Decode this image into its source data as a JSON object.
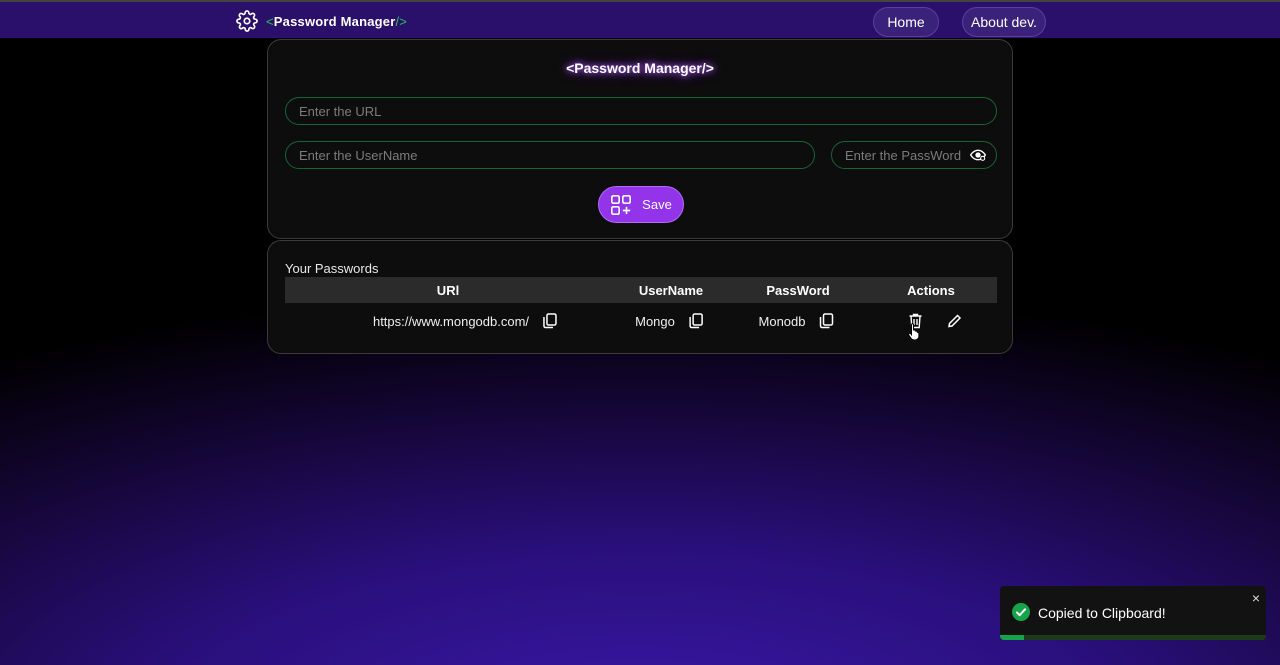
{
  "navbar": {
    "brand_open": "<",
    "brand_name": "Password Manager",
    "brand_close": "/>",
    "brand_icon": "gear-icon",
    "links": [
      {
        "label": "Home"
      },
      {
        "label": "About dev."
      }
    ]
  },
  "form": {
    "title": "<Password Manager/>",
    "url_placeholder": "Enter the URL",
    "url_value": "",
    "username_placeholder": "Enter the UserName",
    "username_value": "",
    "password_placeholder": "Enter the PassWord",
    "password_value": "",
    "save_label": "Save",
    "save_icon": "add-grid-icon",
    "password_toggle_icon": "eye-icon"
  },
  "passwords": {
    "title": "Your Passwords",
    "headers": {
      "url": "URl",
      "username": "UserName",
      "password": "PassWord",
      "actions": "Actions"
    },
    "rows": [
      {
        "url": "https://www.mongodb.com/",
        "username": "Mongo",
        "password": "Monodb"
      }
    ],
    "action_icons": [
      "copy-icon",
      "trash-icon",
      "pencil-icon"
    ]
  },
  "toast": {
    "message": "Copied to Clipboard!",
    "close": "×",
    "progress": 0.09,
    "status_icon": "check-circle-icon"
  },
  "colors": {
    "accent": "#9333ea",
    "nav_bg": "#2a0f6b",
    "field_border": "#166534",
    "brand_green": "#22c55e",
    "toast_progress": "#16a34a"
  }
}
